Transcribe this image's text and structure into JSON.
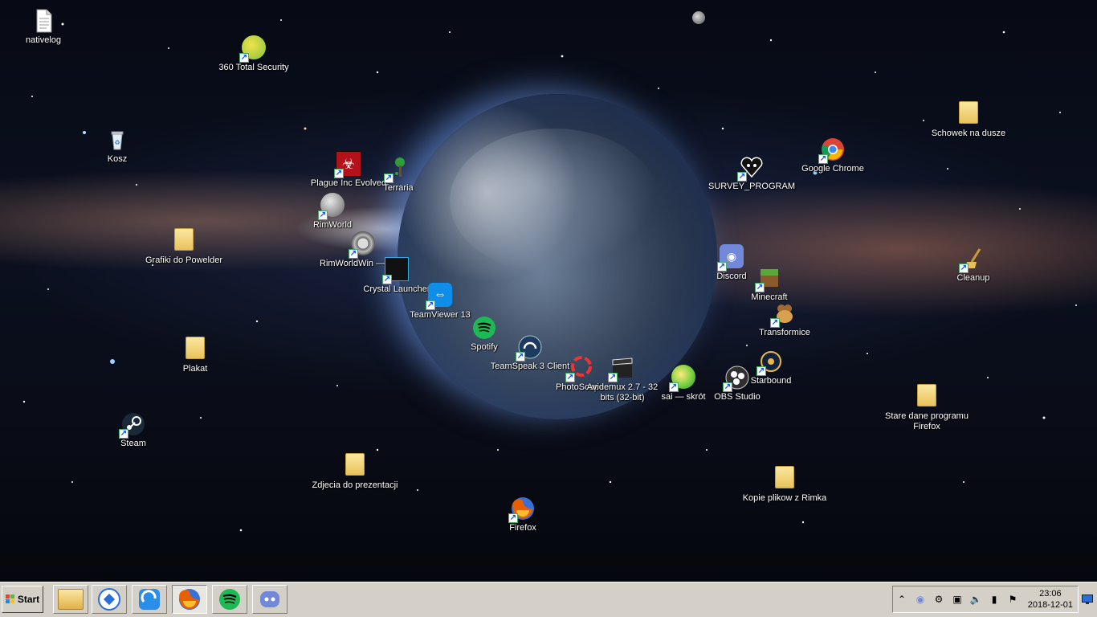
{
  "desktop": {
    "icons": {
      "nativelog": "nativelog",
      "total360": "360 Total Security",
      "kosz": "Kosz",
      "plague": "Plague Inc Evolved",
      "terraria": "Terraria",
      "rimworld": "RimWorld",
      "grafiki": "Grafiki do Powelder",
      "rimworldwin": "RimWorldWin — skrót",
      "crystal": "Crystal Launcher",
      "teamviewer": "TeamViewer 13",
      "spotify": "Spotify",
      "teamspeak": "TeamSpeak 3 Client",
      "plakat": "Plakat",
      "photoscape": "PhotoScape",
      "avidemux": "Avidemux 2.7 - 32 bits (32-bit)",
      "sai": "sai — skrót",
      "obs": "OBS Studio",
      "starbound": "Starbound",
      "steam": "Steam",
      "zdjecia": "Zdjecia do prezentacji",
      "firefox": "Firefox",
      "kopie": "Kopie plikow z Rimka",
      "stare": "Stare dane programu Firefox",
      "schowek": "Schowek na dusze",
      "chrome": "Google Chrome",
      "survey": "SURVEY_PROGRAM",
      "discord": "Discord",
      "minecraft": "Minecraft",
      "transformice": "Transformice",
      "cleanup": "Cleanup"
    }
  },
  "taskbar": {
    "start_label": "Start",
    "pinned": [
      {
        "name": "file-explorer",
        "icon": "folder-icon"
      },
      {
        "name": "app-blue-round",
        "icon": "app-icon"
      },
      {
        "name": "app-blue-arrow",
        "icon": "app-icon"
      },
      {
        "name": "firefox",
        "icon": "firefox-icon"
      },
      {
        "name": "spotify",
        "icon": "spotify-icon"
      },
      {
        "name": "discord",
        "icon": "discord-icon"
      }
    ],
    "tray": {
      "clock_time": "23:06",
      "clock_date": "2018-12-01"
    }
  },
  "colors": {
    "taskbar_bg": "#d4d0c8",
    "firefox_orange": "#e66000",
    "spotify_green": "#1db954",
    "discord_blurple": "#7289da",
    "chrome_red": "#db4437"
  }
}
